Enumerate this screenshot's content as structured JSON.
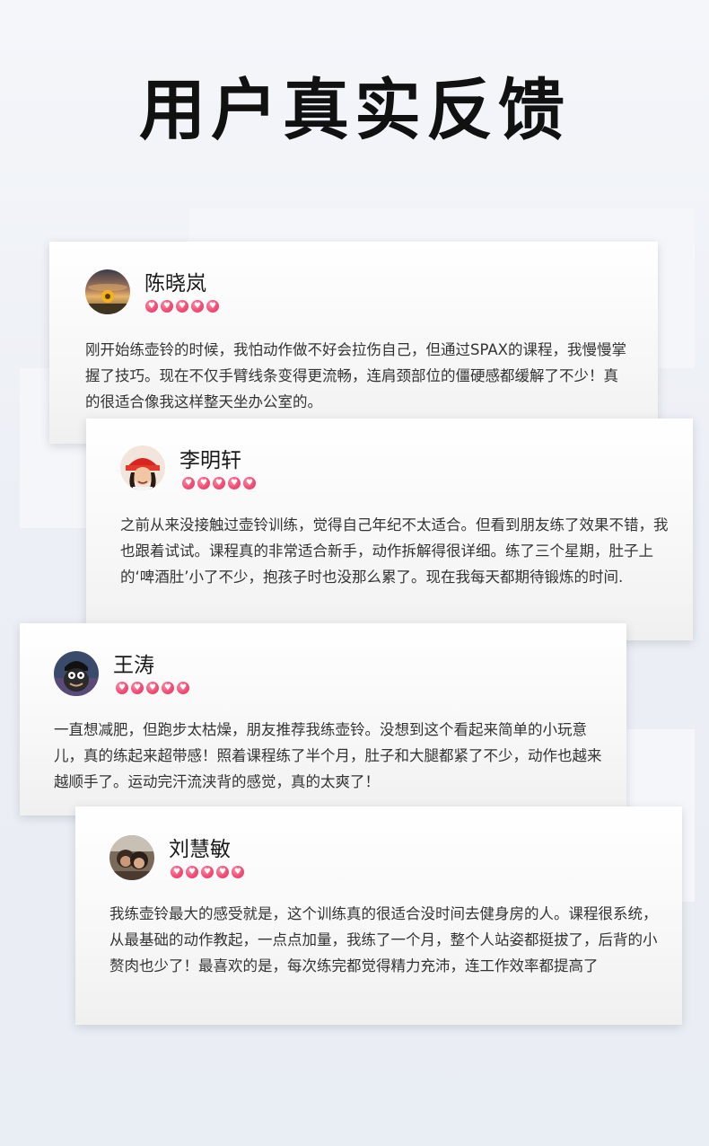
{
  "page": {
    "title": "用户真实反馈"
  },
  "icons": {
    "rating": "heart-icon",
    "rating_glyph": "♥"
  },
  "colors": {
    "rating": "#f24d75",
    "title": "#111111",
    "body_text": "#333333"
  },
  "reviews": [
    {
      "name": "陈晓岚",
      "rating": 5,
      "avatar": "sunflower-sunset-avatar",
      "text": "刚开始练壶铃的时候，我怕动作做不好会拉伤自己，但通过SPAX的课程，我慢慢掌握了技巧。现在不仅手臂线条变得更流畅，连肩颈部位的僵硬感都缓解了不少！真的很适合像我这样整天坐办公室的。"
    },
    {
      "name": "李明轩",
      "rating": 5,
      "avatar": "red-hat-woman-avatar",
      "text": "之前从来没接触过壶铃训练，觉得自己年纪不太适合。但看到朋友练了效果不错，我也跟着试试。课程真的非常适合新手，动作拆解得很详细。练了三个星期，肚子上的‘啤酒肚’小了不少，抱孩子时也没那么累了。现在我每天都期待锻炼的时间."
    },
    {
      "name": "王涛",
      "rating": 5,
      "avatar": "cartoon-character-avatar",
      "text": "一直想减肥，但跑步太枯燥，朋友推荐我练壶铃。没想到这个看起来简单的小玩意儿，真的练起来超带感！照着课程练了半个月，肚子和大腿都紧了不少，动作也越来越顺手了。运动完汗流浃背的感觉，真的太爽了！"
    },
    {
      "name": "刘慧敏",
      "rating": 5,
      "avatar": "couple-photo-avatar",
      "text": "我练壶铃最大的感受就是，这个训练真的很适合没时间去健身房的人。课程很系统，从最基础的动作教起，一点点加量，我练了一个月，整个人站姿都挺拔了，后背的小赘肉也少了！最喜欢的是，每次练完都觉得精力充沛，连工作效率都提高了"
    }
  ]
}
